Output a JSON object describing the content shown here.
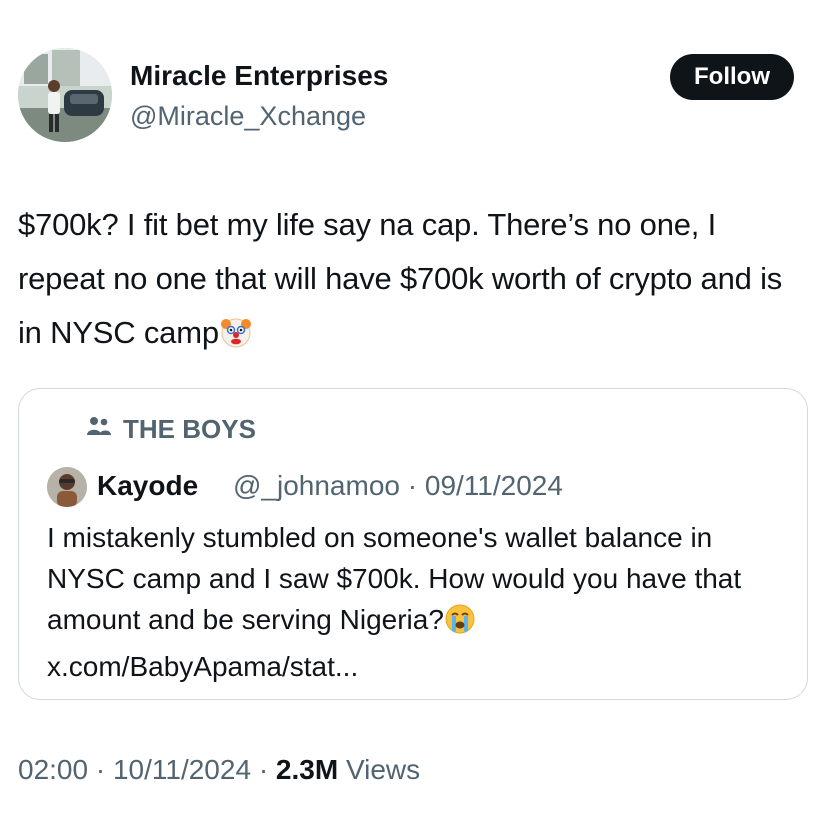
{
  "author": {
    "name": "Miracle Enterprises",
    "handle": "@Miracle_Xchange",
    "avatar_icon": "profile-photo"
  },
  "follow_label": "Follow",
  "tweet": {
    "text": "$700k? I fit bet my life say na cap. There’s no one, I repeat no one that will have $700k worth of crypto and is in NYSC camp",
    "emoji": "clown-face-icon"
  },
  "quote": {
    "community": "THE BOYS",
    "community_icon": "people-icon",
    "author_name": "Kayode",
    "author_handle": "@_johnamoo",
    "separator": "·",
    "date": "09/11/2024",
    "text": "I mistakenly stumbled on someone's wallet balance in NYSC camp and I saw $700k. How would you have that amount and be serving Nigeria?",
    "emoji": "crying-face-icon",
    "link": "x.com/BabyApama/stat..."
  },
  "meta": {
    "time": "02:00",
    "sep1": "·",
    "date": "10/11/2024",
    "sep2": "·",
    "views_count": "2.3M",
    "views_label": "Views"
  },
  "colors": {
    "text": "#0f1419",
    "secondary": "#536471",
    "border": "#cfd9de",
    "button": "#0f1419"
  }
}
